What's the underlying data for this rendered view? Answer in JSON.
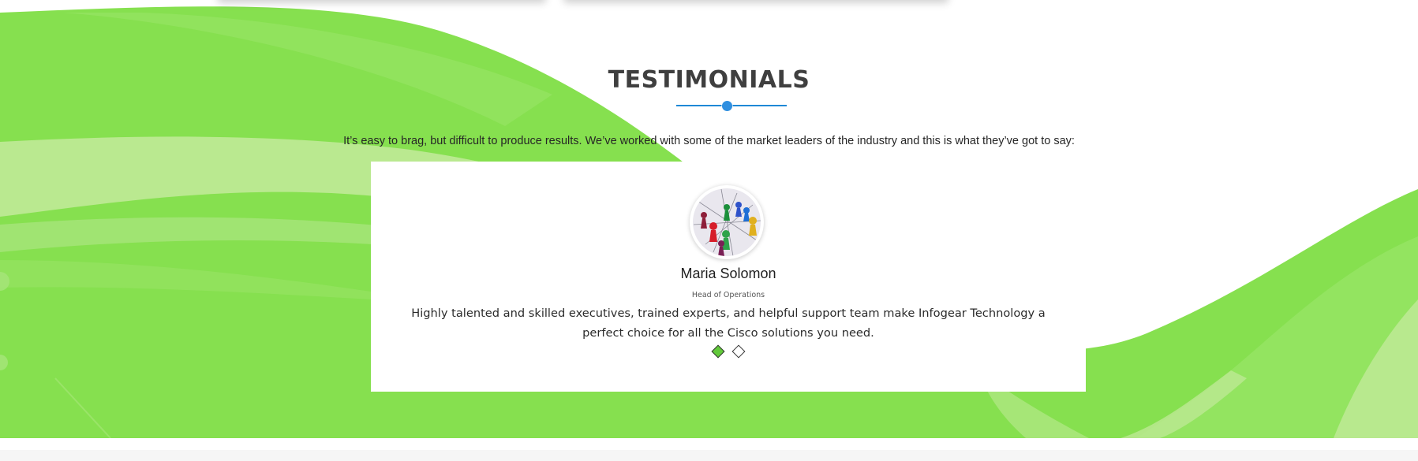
{
  "colors": {
    "brand_green": "#86e04f",
    "accent_blue": "#1e88d6",
    "active_dot": "#62c93a"
  },
  "testimonials": {
    "title": "TESTIMONIALS",
    "intro": "It’s easy to brag, but difficult to produce results. We’ve worked with some of the market leaders of the industry and this is what they’ve got to say:",
    "current": {
      "name": "Maria Solomon",
      "role": "Head of Operations",
      "quote": "Highly talented and skilled executives, trained experts, and helpful support team make Infogear Technology a perfect choice for all the Cisco solutions you need."
    },
    "slider": {
      "slides_count": 2,
      "active_index": 0
    }
  }
}
